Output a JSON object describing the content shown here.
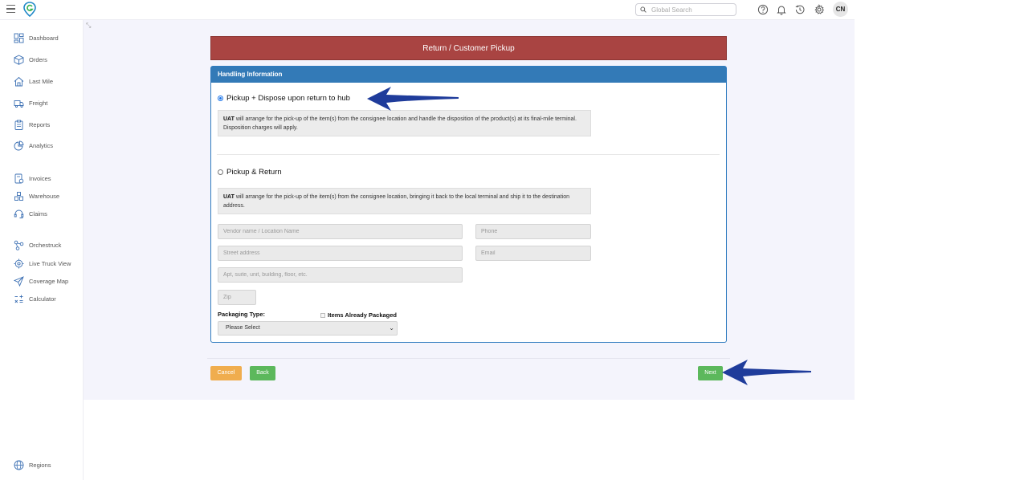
{
  "topbar": {
    "search_placeholder": "Global Search",
    "avatar_initials": "CN"
  },
  "sidebar": {
    "items": [
      {
        "label": "Dashboard",
        "icon": "dashboard-icon"
      },
      {
        "label": "Orders",
        "icon": "box-icon"
      },
      {
        "label": "Last Mile",
        "icon": "house-icon"
      },
      {
        "label": "Freight",
        "icon": "truck-icon"
      },
      {
        "label": "Reports",
        "icon": "clipboard-icon"
      },
      {
        "label": "Analytics",
        "icon": "analytics-icon"
      },
      {
        "label": "Invoices",
        "icon": "invoice-icon"
      },
      {
        "label": "Warehouse",
        "icon": "warehouse-icon"
      },
      {
        "label": "Claims",
        "icon": "headset-icon"
      },
      {
        "label": "Orchestruck",
        "icon": "nodes-icon"
      },
      {
        "label": "Live Truck View",
        "icon": "target-icon"
      },
      {
        "label": "Coverage Map",
        "icon": "send-icon"
      },
      {
        "label": "Calculator",
        "icon": "calculator-icon"
      }
    ],
    "bottom_item": {
      "label": "Regions",
      "icon": "globe-icon"
    }
  },
  "form": {
    "title": "Return / Customer Pickup",
    "panel_title": "Handling Information",
    "option1": {
      "label": "Pickup + Dispose upon return to hub",
      "checked": true,
      "desc_bold": "UAT",
      "desc": " will arrange for the pick-up of the item(s) from the consignee location and handle the disposition of the product(s) at its final-mile terminal. Disposition charges will apply."
    },
    "option2": {
      "label": "Pickup & Return",
      "checked": false,
      "desc_bold": "UAT",
      "desc": " will arrange for the pick-up of the item(s) from the consignee location, bringing it back to the local terminal and ship it to the destination address."
    },
    "fields": {
      "vendor_placeholder": "Vendor name / Location Name",
      "phone_placeholder": "Phone",
      "street_placeholder": "Street address",
      "email_placeholder": "Email",
      "apt_placeholder": "Apt, suite, unit, building, floor, etc.",
      "zip_placeholder": "Zip"
    },
    "packaging_label": "Packaging Type:",
    "already_packaged_label": "Items Already Packaged",
    "packaging_select_value": "Please Select"
  },
  "buttons": {
    "cancel": "Cancel",
    "back": "Back",
    "next": "Next"
  },
  "colors": {
    "title_bar": "#a94442",
    "panel_header": "#337ab7",
    "cancel": "#f0ad4e",
    "success": "#5cb85c",
    "annotation_arrow": "#1f3c9b"
  }
}
